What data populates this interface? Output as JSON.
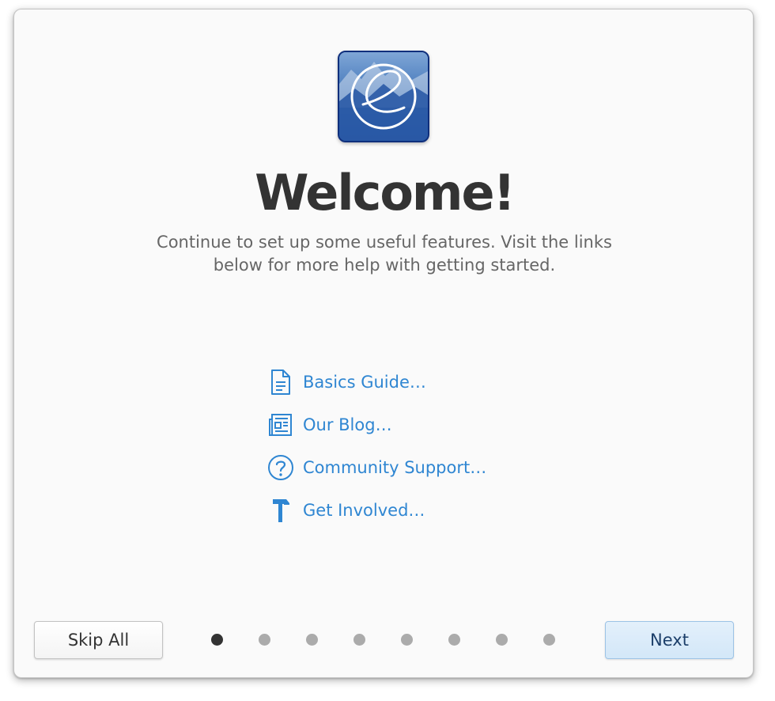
{
  "window": {
    "title": "Welcome!",
    "subtitle": "Continue to set up some useful features. Visit the links below for more help with getting started."
  },
  "links": [
    {
      "label": "Basics Guide…",
      "icon": "document-icon"
    },
    {
      "label": "Our Blog…",
      "icon": "newspaper-icon"
    },
    {
      "label": "Community Support…",
      "icon": "help-icon"
    },
    {
      "label": "Get Involved…",
      "icon": "hammer-icon"
    }
  ],
  "footer": {
    "skip_label": "Skip All",
    "next_label": "Next",
    "page_count": 8,
    "current_page": 1
  },
  "colors": {
    "link": "#2f86d2",
    "title": "#333333",
    "subtitle": "#666666",
    "next_button_bg": "#d9ebfa"
  }
}
